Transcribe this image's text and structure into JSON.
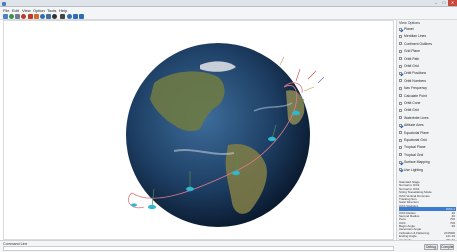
{
  "window": {
    "title": "",
    "min": "–",
    "max": "□",
    "close": "✕"
  },
  "menu": [
    "File",
    "Edit",
    "View",
    "Option",
    "Tools",
    "Help"
  ],
  "toolbar": {
    "icons": [
      "open-icon",
      "search-icon",
      "pan-icon",
      "measure-icon",
      "shape-icon",
      "shape-icon",
      "play-icon",
      "nav-icon",
      "camera-icon",
      "stop-icon",
      "zoom-icon",
      "settings-icon"
    ],
    "colors": [
      "#4a7fc1",
      "#3d8f4a",
      "#6b7d91",
      "#c03a2b",
      "#c03a2b",
      "#d26a2c",
      "#2f6db5",
      "#3f6f9f",
      "#333333",
      "#444444",
      "#2f6db5",
      "#2f6db5"
    ]
  },
  "view_options": {
    "title": "View Options",
    "items": [
      {
        "label": "Planet",
        "checked": true
      },
      {
        "label": "Meridian Lines",
        "checked": false
      },
      {
        "label": "Continent Outlines",
        "checked": false
      },
      {
        "label": "Grid Plane",
        "checked": false
      },
      {
        "label": "Orbit Path",
        "checked": false
      },
      {
        "label": "Orbit Grid",
        "checked": false
      },
      {
        "label": "Orbit Positions",
        "checked": true
      },
      {
        "label": "Orbit Numbers",
        "checked": false
      },
      {
        "label": "Nav Frequency",
        "checked": false
      },
      {
        "label": "Calculate Point",
        "checked": false
      },
      {
        "label": "Orbit Cone",
        "checked": false
      },
      {
        "label": "Orbit Grid",
        "checked": false
      },
      {
        "label": "Waterbrite Lines",
        "checked": false
      },
      {
        "label": "Altitude Axes",
        "checked": true
      },
      {
        "label": "Equatorial Plane",
        "checked": false
      },
      {
        "label": "Equatorial Grid",
        "checked": false
      },
      {
        "label": "Tropical Plane",
        "checked": false
      },
      {
        "label": "Tropical Grid",
        "checked": false
      },
      {
        "label": "Surface Mapping",
        "checked": true
      },
      {
        "label": "Use Lighting",
        "checked": true
      }
    ]
  },
  "stats": {
    "lines": [
      "Standard Stage",
      "Normal to Orbit",
      "Normal to Orbit",
      "String Tessellating Mode",
      "Orbit Vertical Dummies",
      "Tracking Sun",
      "Solar Direction"
    ],
    "header": "Orbit Statistics",
    "rows": [
      {
        "label": "",
        "value": "Orbit 1",
        "highlight": true
      },
      {
        "label": "Orbit Radius",
        "value": "40"
      },
      {
        "label": "Second Radius",
        "value": "40"
      },
      {
        "label": "Perm.",
        "value": "700"
      },
      {
        "label": "Orbit",
        "value": "700"
      },
      {
        "label": "Begin Angle",
        "value": "90"
      },
      {
        "label": "Ascension Angle",
        "value": ""
      },
      {
        "label": "Inclination & Flattening",
        "value": "20.8000"
      },
      {
        "label": "Ending Angle",
        "value": "121.19"
      },
      {
        "label": "Arc Angle",
        "value": "231.71"
      }
    ]
  },
  "status": {
    "label": "Command Line",
    "input_value": ""
  },
  "buttons": {
    "debug": "Debug",
    "compile": "Compile"
  }
}
